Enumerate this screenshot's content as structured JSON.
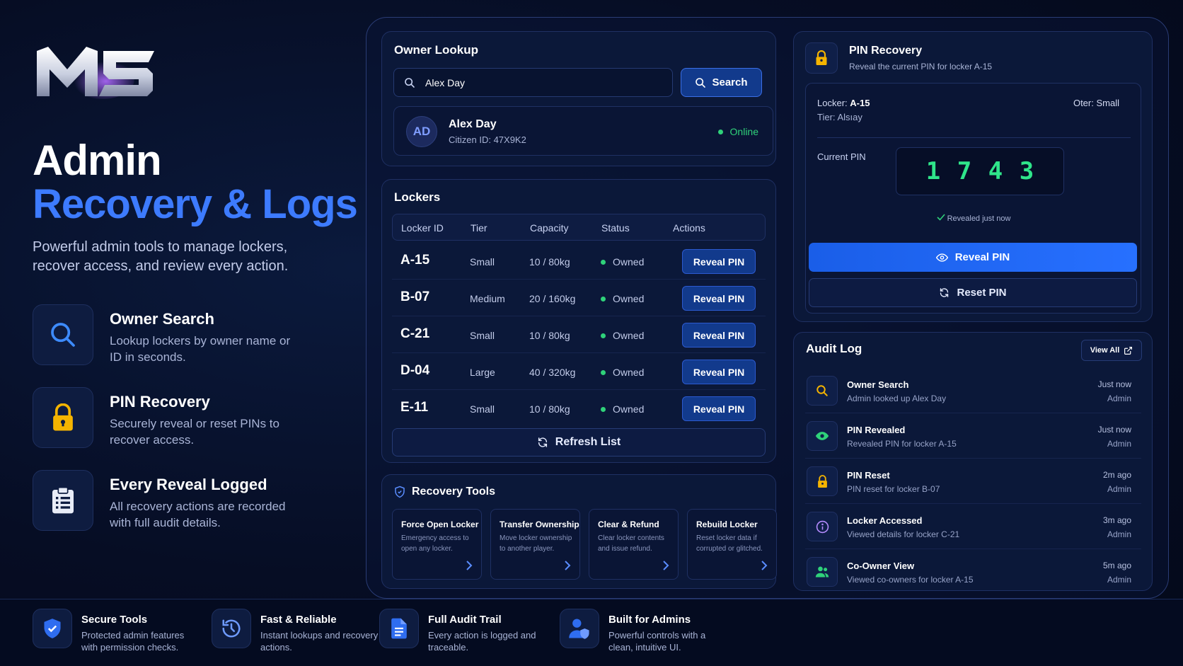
{
  "hero": {
    "logo_text": "MS",
    "title_line1": "Admin",
    "title_line2": "Recovery & Logs",
    "subtitle": "Powerful admin tools to manage lockers, recover access, and review every action."
  },
  "features": [
    {
      "title": "Owner Search",
      "desc": "Lookup lockers by owner name or ID in seconds.",
      "icon": "search-icon"
    },
    {
      "title": "PIN Recovery",
      "desc": "Securely reveal or reset PINs to recover access.",
      "icon": "lock-icon"
    },
    {
      "title": "Every Reveal Logged",
      "desc": "All recovery actions are recorded with full audit details.",
      "icon": "clipboard-icon"
    }
  ],
  "owner_lookup": {
    "title": "Owner Lookup",
    "search_value": "Alex Day",
    "search_label": "Search",
    "owner": {
      "initials": "AD",
      "name": "Alex Day",
      "citizen_id": "Citizen ID: 47X9K2",
      "status": "Online"
    }
  },
  "lockers": {
    "title": "Lockers",
    "headers": [
      "Locker ID",
      "Tier",
      "Capacity",
      "Status",
      "Actions"
    ],
    "rows": [
      {
        "id": "A-15",
        "tier": "Small",
        "capacity": "10 / 80kg",
        "status": "Owned",
        "action": "Reveal PIN"
      },
      {
        "id": "B-07",
        "tier": "Medium",
        "capacity": "20 / 160kg",
        "status": "Owned",
        "action": "Reveal PIN"
      },
      {
        "id": "C-21",
        "tier": "Small",
        "capacity": "10 / 80kg",
        "status": "Owned",
        "action": "Reveal PIN"
      },
      {
        "id": "D-04",
        "tier": "Large",
        "capacity": "40 / 320kg",
        "status": "Owned",
        "action": "Reveal PIN"
      },
      {
        "id": "E-11",
        "tier": "Small",
        "capacity": "10 / 80kg",
        "status": "Owned",
        "action": "Reveal PIN"
      }
    ],
    "refresh_label": "Refresh List"
  },
  "recovery_tools": {
    "title": "Recovery Tools",
    "tools": [
      {
        "title": "Force Open Locker",
        "desc": "Emergency access to open any locker."
      },
      {
        "title": "Transfer Ownership",
        "desc": "Move locker ownership to another player."
      },
      {
        "title": "Clear & Refund",
        "desc": "Clear locker contents and issue refund."
      },
      {
        "title": "Rebuild Locker",
        "desc": "Reset locker data if corrupted or glitched."
      }
    ]
  },
  "pin_recovery": {
    "title": "PIN Recovery",
    "subtitle": "Reveal the current PIN for locker A-15",
    "locker_label": "Locker:",
    "locker_value": "A-15",
    "other_label": "Otеr:",
    "other_value": "Small",
    "tier_label": "Tier:",
    "tier_value": "Alsıay",
    "current_pin_label": "Current PIN",
    "digits": [
      "1",
      "7",
      "4",
      "3"
    ],
    "revealed_note": "Revealed just now",
    "reveal_label": "Reveal PIN",
    "reset_label": "Reset PIN"
  },
  "audit_log": {
    "title": "Audit Log",
    "view_all": "View All",
    "entries": [
      {
        "title": "Owner Search",
        "desc": "Admin looked up Alex Day",
        "when": "Just now",
        "actor": "Admin",
        "icon": "search-icon"
      },
      {
        "title": "PIN Revealed",
        "desc": "Revealed PIN for locker A-15",
        "when": "Just now",
        "actor": "Admin",
        "icon": "eye-icon"
      },
      {
        "title": "PIN Reset",
        "desc": "PIN reset for locker B-07",
        "when": "2m ago",
        "actor": "Admin",
        "icon": "lock-icon"
      },
      {
        "title": "Locker Accessed",
        "desc": "Viewed details for locker C-21",
        "when": "3m ago",
        "actor": "Admin",
        "icon": "info-icon"
      },
      {
        "title": "Co-Owner View",
        "desc": "Viewed co-owners for locker A-15",
        "when": "5m ago",
        "actor": "Admin",
        "icon": "users-icon"
      }
    ]
  },
  "footer": [
    {
      "title": "Secure Tools",
      "desc": "Protected admin features with permission checks.",
      "icon": "shield-icon"
    },
    {
      "title": "Fast & Reliable",
      "desc": "Instant lookups and recovery actions.",
      "icon": "history-icon"
    },
    {
      "title": "Full Audit Trail",
      "desc": "Every action is logged and traceable.",
      "icon": "document-icon"
    },
    {
      "title": "Built for Admins",
      "desc": "Powerful controls with a clean, intuitive UI.",
      "icon": "admin-user-icon"
    }
  ],
  "colors": {
    "accent": "#3d7bff",
    "success": "#2fd27a",
    "warning": "#f5b400",
    "background": "#060d24"
  }
}
